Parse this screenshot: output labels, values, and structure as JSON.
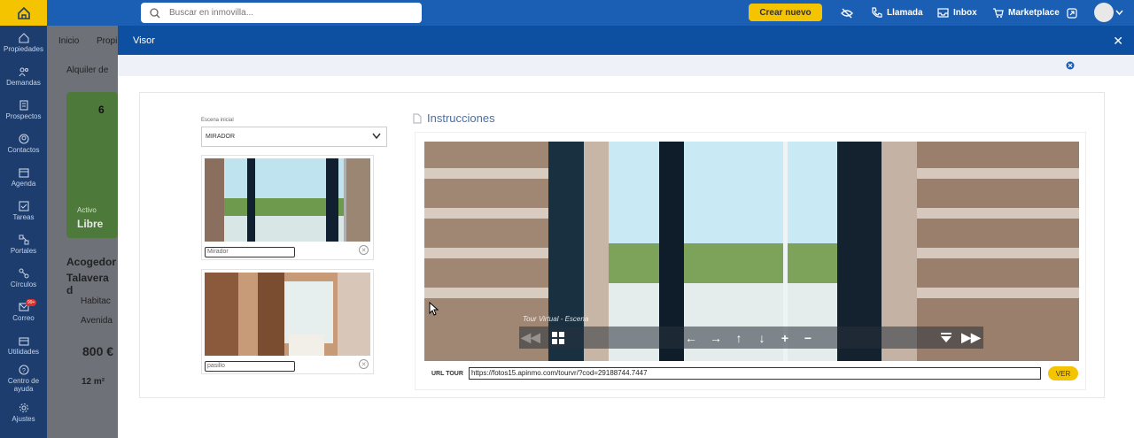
{
  "topbar": {
    "search_placeholder": "Buscar en inmovilla...",
    "new_button": "Crear nuevo",
    "call": "Llamada",
    "inbox": "Inbox",
    "marketplace": "Marketplace"
  },
  "sidebar": {
    "items": [
      {
        "label": "Propiedades"
      },
      {
        "label": "Demandas"
      },
      {
        "label": "Prospectos"
      },
      {
        "label": "Contactos"
      },
      {
        "label": "Agenda"
      },
      {
        "label": "Tareas"
      },
      {
        "label": "Portales"
      },
      {
        "label": "Círculos"
      },
      {
        "label": "Correo",
        "badge": "99+"
      },
      {
        "label": "Utilidades"
      },
      {
        "label": "Centro de ayuda"
      },
      {
        "label": "Ajustes"
      }
    ]
  },
  "background": {
    "breadcrumb_home": "Inicio",
    "breadcrumb_next": "Propi",
    "rent_label": "Alquiler de",
    "photo_count": "6",
    "status_active": "Activo",
    "status_free": "Libre",
    "title_line1": "Acogedor",
    "title_line2": "Talavera d",
    "rooms": "Habitac",
    "address": "Avenida",
    "price": "800 €",
    "area": "12 m²"
  },
  "modal": {
    "title": "Visor",
    "initial_scene_label": "Escena inicial",
    "initial_scene_value": "MIRADOR",
    "scenes": [
      {
        "name": "Mirador"
      },
      {
        "name": "pasillo"
      }
    ],
    "instructions": "Instrucciones",
    "tour_label": "Tour Virtual - Escena",
    "url_label": "URL TOUR",
    "url_value": "https://fotos15.apinmo.com/tourvr/?cod=29188744.7447",
    "view_button": "VER"
  }
}
